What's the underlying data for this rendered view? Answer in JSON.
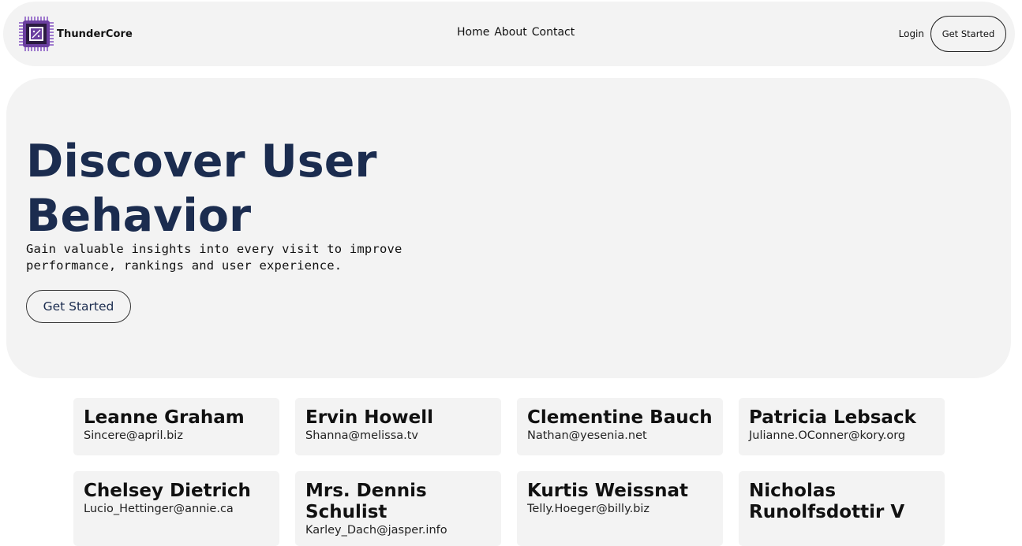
{
  "nav": {
    "brand": "ThunderCore",
    "logo_icon": "cpu-chip-icon",
    "links": [
      "Home",
      "About",
      "Contact"
    ],
    "login": "Login",
    "cta": "Get Started"
  },
  "hero": {
    "title_line1": "Discover User",
    "title_line2": "Behavior",
    "subtitle": "Gain valuable insights into every visit to improve performance, rankings and user experience.",
    "cta": "Get Started"
  },
  "users": [
    {
      "name": "Leanne Graham",
      "email": "Sincere@april.biz"
    },
    {
      "name": "Ervin Howell",
      "email": "Shanna@melissa.tv"
    },
    {
      "name": "Clementine Bauch",
      "email": "Nathan@yesenia.net"
    },
    {
      "name": "Patricia Lebsack",
      "email": "Julianne.OConner@kory.org"
    },
    {
      "name": "Chelsey Dietrich",
      "email": "Lucio_Hettinger@annie.ca"
    },
    {
      "name": "Mrs. Dennis Schulist",
      "email": "Karley_Dach@jasper.info"
    },
    {
      "name": "Kurtis Weissnat",
      "email": "Telly.Hoeger@billy.biz"
    },
    {
      "name": "Nicholas Runolfsdottir V",
      "email": ""
    }
  ],
  "colors": {
    "panel": "#f3f3f3",
    "heading": "#1b2c4f",
    "logo_purple": "#6b3fa0"
  }
}
